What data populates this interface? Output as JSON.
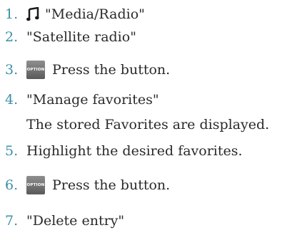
{
  "steps": [
    {
      "num": "1.",
      "text": "\"Media/Radio\"",
      "icon": "music-note-icon"
    },
    {
      "num": "2.",
      "text": "\"Satellite radio\""
    },
    {
      "num": "3.",
      "text": "Press the button.",
      "icon": "option-button-icon",
      "icon_label": "OPTION"
    },
    {
      "num": "4.",
      "text": "\"Manage favorites\"",
      "subtext": "The stored Favorites are displayed."
    },
    {
      "num": "5.",
      "text": "Highlight the desired favorites."
    },
    {
      "num": "6.",
      "text": "Press the button.",
      "icon": "option-button-icon",
      "icon_label": "OPTION"
    },
    {
      "num": "7.",
      "text": "\"Delete entry\""
    }
  ],
  "colors": {
    "number": "#3a8fa8",
    "text": "#2a2a2a",
    "button": "#6e6e6e"
  }
}
